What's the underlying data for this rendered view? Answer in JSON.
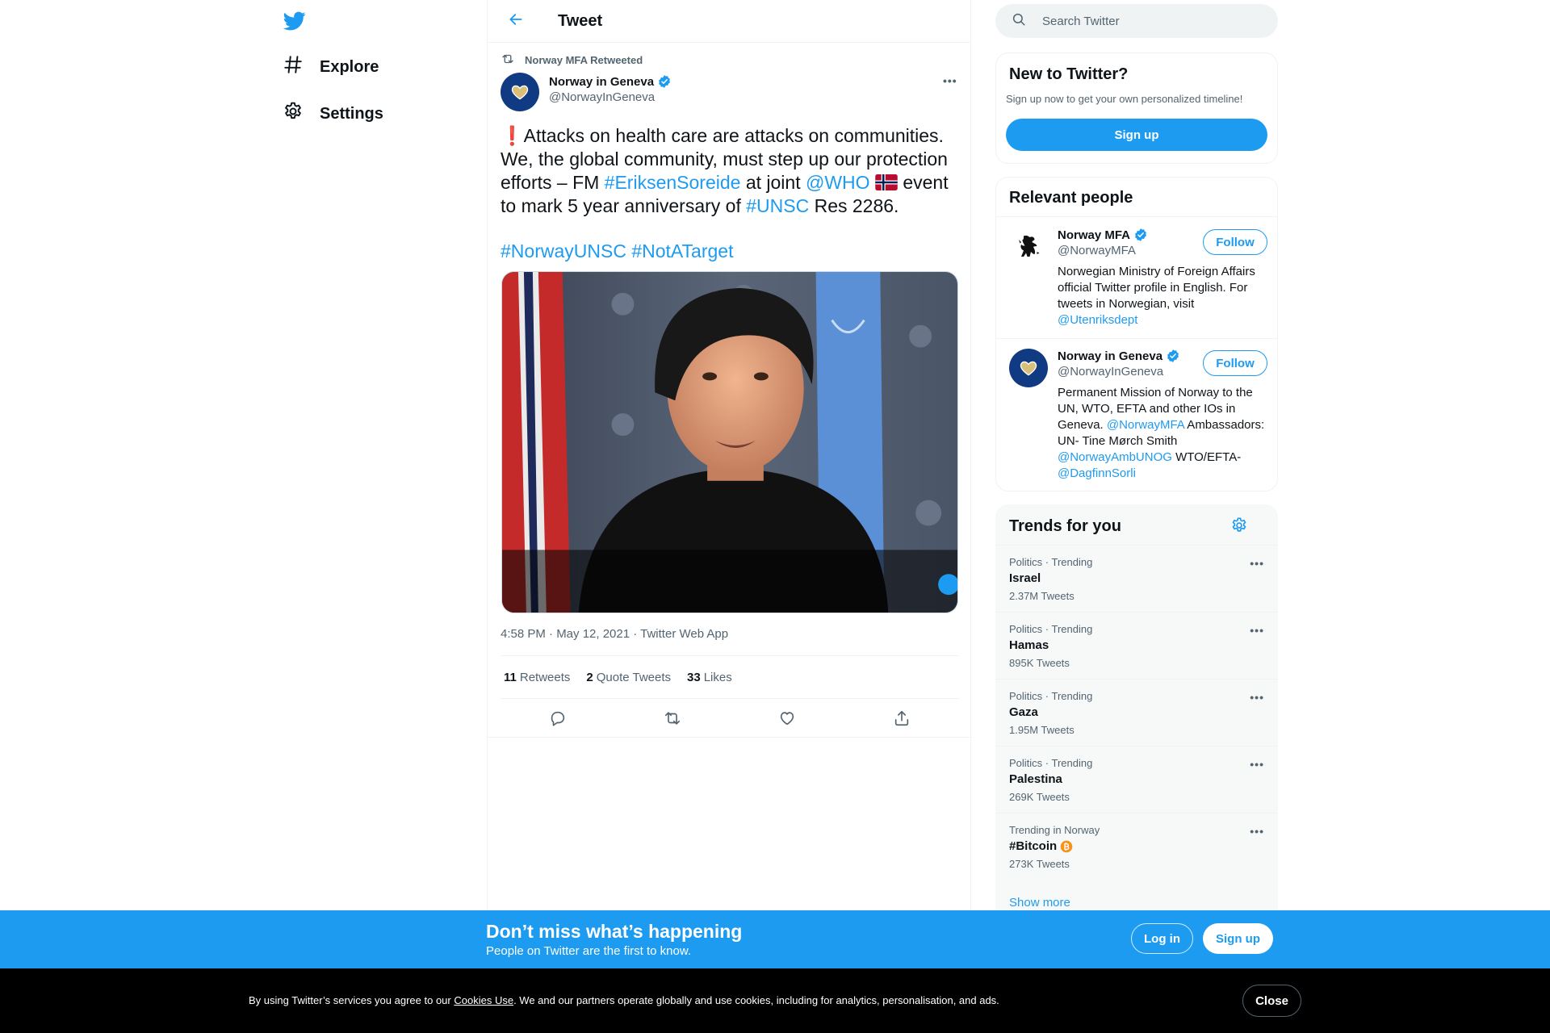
{
  "nav": {
    "logo_icon": "twitter-bird-icon",
    "items": [
      {
        "label": "Explore",
        "icon": "hashtag-icon"
      },
      {
        "label": "Settings",
        "icon": "gear-icon"
      }
    ]
  },
  "header": {
    "title": "Tweet",
    "back_icon": "arrow-left-icon"
  },
  "tweet": {
    "retweeted_by": "Norway MFA Retweeted",
    "author_name": "Norway in Geneva",
    "author_handle": "@NorwayInGeneva",
    "text": {
      "exclaim": "❗",
      "part1": "Attacks on health care are attacks on communities. We, the global community, must step up our protection efforts – FM ",
      "tag_eriksen": "#EriksenSoreide",
      "part2": " at joint ",
      "mention_who": "@WHO",
      "part3": " event to mark 5 year anniversary of ",
      "tag_unsc": "#UNSC",
      "part4": " Res 2286.",
      "tag_norwayunsc": "#NorwayUNSC",
      "tag_notatarget": "#NotATarget"
    },
    "timestamp": "4:58 PM · May 12, 2021 · Twitter Web App",
    "stats": {
      "retweets_count": "11",
      "retweets_label": "Retweets",
      "quotes_count": "2",
      "quotes_label": "Quote Tweets",
      "likes_count": "33",
      "likes_label": "Likes"
    },
    "actions": [
      "reply-icon",
      "retweet-icon",
      "like-icon",
      "share-icon"
    ]
  },
  "search": {
    "placeholder": "Search Twitter"
  },
  "new_to_twitter": {
    "title": "New to Twitter?",
    "subtitle": "Sign up now to get your own personalized timeline!",
    "signup_label": "Sign up"
  },
  "relevant_people": {
    "title": "Relevant people",
    "follow_label": "Follow",
    "people": [
      {
        "name": "Norway MFA",
        "handle": "@NorwayMFA",
        "bio_text": "Norwegian Ministry of Foreign Affairs official Twitter profile in English. For tweets in Norwegian, visit ",
        "bio_link": "@Utenriksdept"
      },
      {
        "name": "Norway in Geneva",
        "handle": "@NorwayInGeneva",
        "bio_text1": "Permanent Mission of Norway to the UN, WTO, EFTA and other IOs in Geneva. ",
        "bio_link1": "@NorwayMFA",
        "bio_text2": " Ambassadors: UN- Tine Mørch Smith ",
        "bio_link2": "@NorwayAmbUNOG",
        "bio_text3": " WTO/EFTA- ",
        "bio_link3": "@DagfinnSorli"
      }
    ]
  },
  "trends": {
    "title": "Trends for you",
    "items": [
      {
        "meta": "Politics · Trending",
        "name": "Israel",
        "count": "2.37M Tweets"
      },
      {
        "meta": "Politics · Trending",
        "name": "Hamas",
        "count": "895K Tweets"
      },
      {
        "meta": "Politics · Trending",
        "name": "Gaza",
        "count": "1.95M Tweets"
      },
      {
        "meta": "Politics · Trending",
        "name": "Palestina",
        "count": "269K Tweets"
      },
      {
        "meta": "Trending in Norway",
        "name": "#Bitcoin",
        "count": "273K Tweets"
      }
    ],
    "show_more": "Show more"
  },
  "banner": {
    "title": "Don’t miss what’s happening",
    "subtitle": "People on Twitter are the first to know.",
    "login_label": "Log in",
    "signup_label": "Sign up"
  },
  "cookie": {
    "text1": "By using Twitter’s services you agree to our ",
    "link": "Cookies Use",
    "text2": ". We and our partners operate globally and use cookies, including for analytics, personalisation, and ads.",
    "close_label": "Close"
  },
  "colors": {
    "accent": "#1d9bf0",
    "text": "#0f1419",
    "muted": "#536471",
    "cookie_bg": "#000000"
  }
}
